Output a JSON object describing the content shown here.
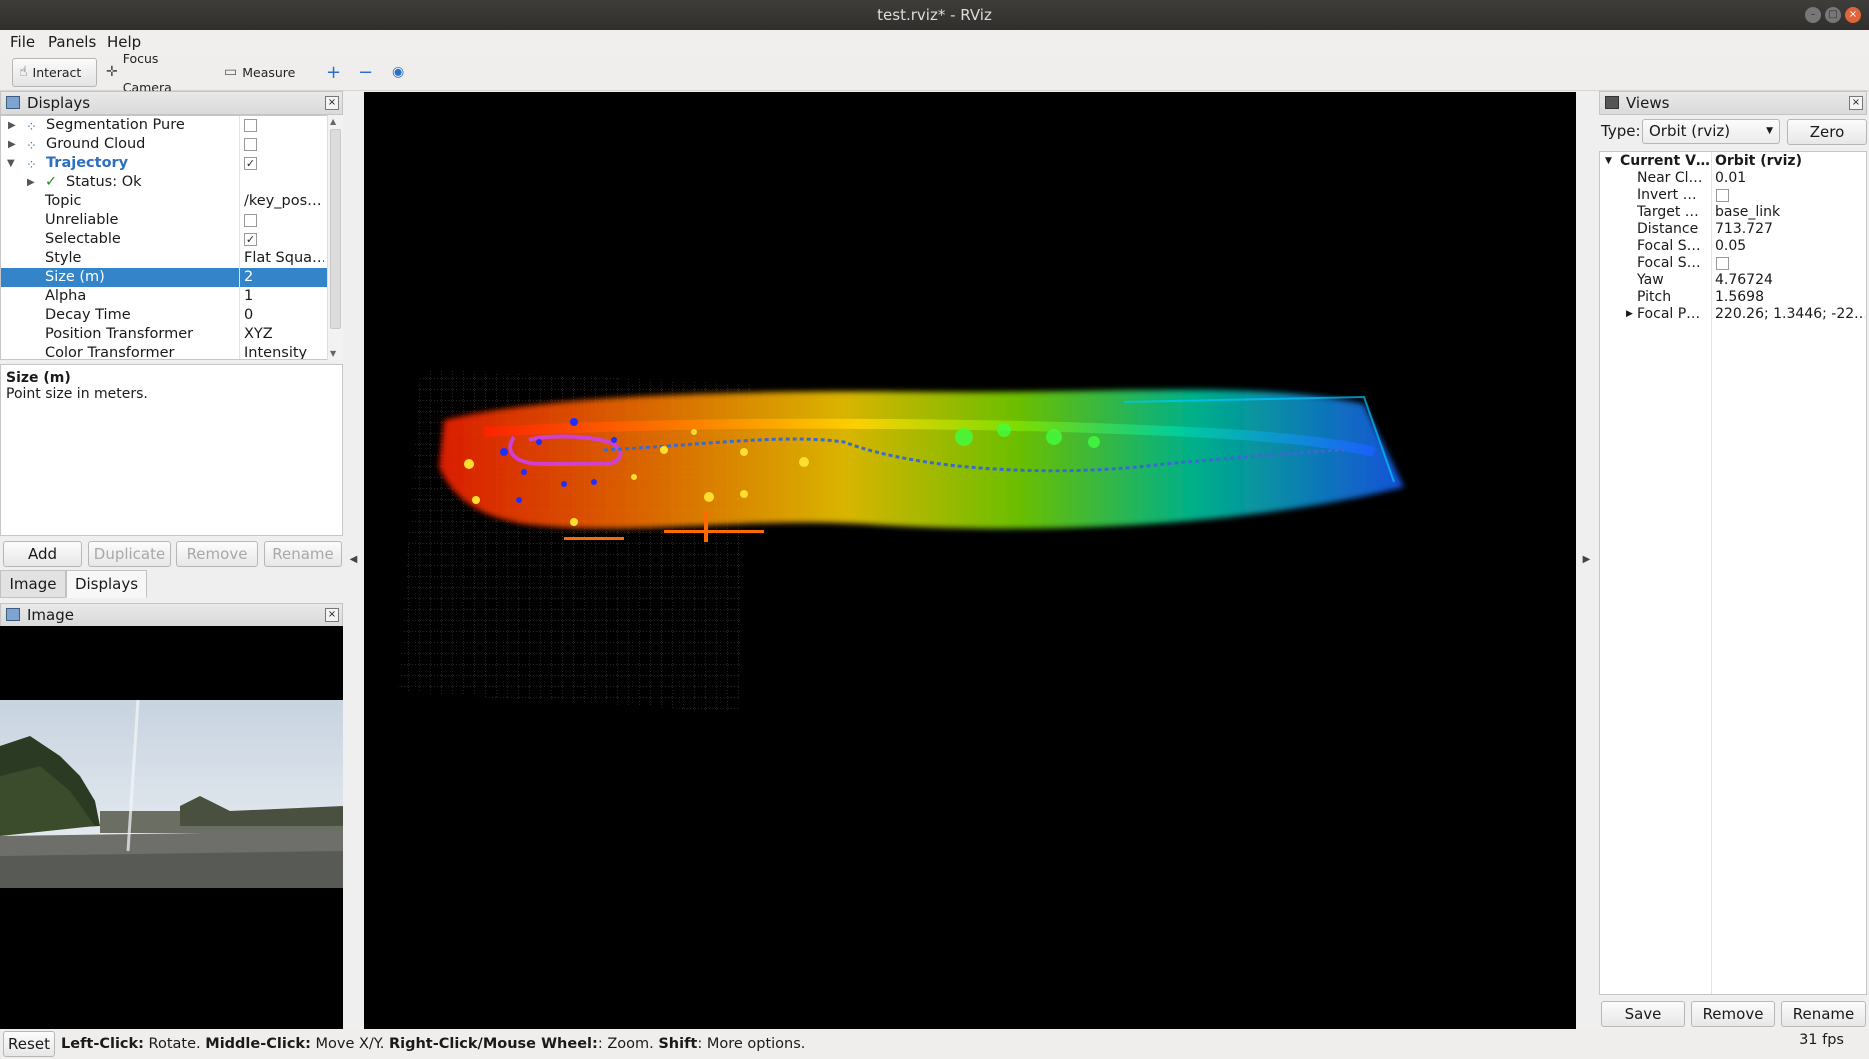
{
  "window": {
    "title": "test.rviz* - RViz"
  },
  "menu": [
    "File",
    "Panels",
    "Help"
  ],
  "toolbar": {
    "interact": "Interact",
    "focus_camera": "Focus Camera",
    "measure": "Measure"
  },
  "displays_panel": {
    "title": "Displays",
    "rows": [
      {
        "label": "Segmentation Pure",
        "value": ""
      },
      {
        "label": "Ground Cloud",
        "value": ""
      },
      {
        "label": "Trajectory",
        "value": ""
      },
      {
        "label": "Status: Ok",
        "value": ""
      },
      {
        "label": "Topic",
        "value": "/key_pos…"
      },
      {
        "label": "Unreliable",
        "value": ""
      },
      {
        "label": "Selectable",
        "value": ""
      },
      {
        "label": "Style",
        "value": "Flat Squa…"
      },
      {
        "label": "Size (m)",
        "value": "2"
      },
      {
        "label": "Alpha",
        "value": "1"
      },
      {
        "label": "Decay Time",
        "value": "0"
      },
      {
        "label": "Position Transformer",
        "value": "XYZ"
      },
      {
        "label": "Color Transformer",
        "value": "Intensity"
      }
    ],
    "description_title": "Size (m)",
    "description_text": "Point size in meters.",
    "buttons": {
      "add": "Add",
      "duplicate": "Duplicate",
      "remove": "Remove",
      "rename": "Rename"
    },
    "tabs": [
      "Image",
      "Displays"
    ]
  },
  "image_panel": {
    "title": "Image"
  },
  "views_panel": {
    "title": "Views",
    "type_label": "Type:",
    "type_value": "Orbit (rviz)",
    "zero": "Zero",
    "rows": [
      {
        "label": "Current V…",
        "value": "Orbit (rviz)"
      },
      {
        "label": "Near Cl…",
        "value": "0.01"
      },
      {
        "label": "Invert …",
        "value": ""
      },
      {
        "label": "Target …",
        "value": "base_link"
      },
      {
        "label": "Distance",
        "value": "713.727"
      },
      {
        "label": "Focal S…",
        "value": "0.05"
      },
      {
        "label": "Focal S…",
        "value": ""
      },
      {
        "label": "Yaw",
        "value": "4.76724"
      },
      {
        "label": "Pitch",
        "value": "1.5698"
      },
      {
        "label": "Focal P…",
        "value": "220.26; 1.3446; -22.…"
      }
    ],
    "buttons": {
      "save": "Save",
      "remove": "Remove",
      "rename": "Rename"
    }
  },
  "statusbar": {
    "reset": "Reset",
    "k1": "Left-Click:",
    "v1": " Rotate. ",
    "k2": "Middle-Click:",
    "v2": " Move X/Y. ",
    "k3": "Right-Click/Mouse Wheel:",
    "v3": ": Zoom. ",
    "k4": "Shift",
    "v4": ": More options.",
    "fps": "31 fps"
  }
}
